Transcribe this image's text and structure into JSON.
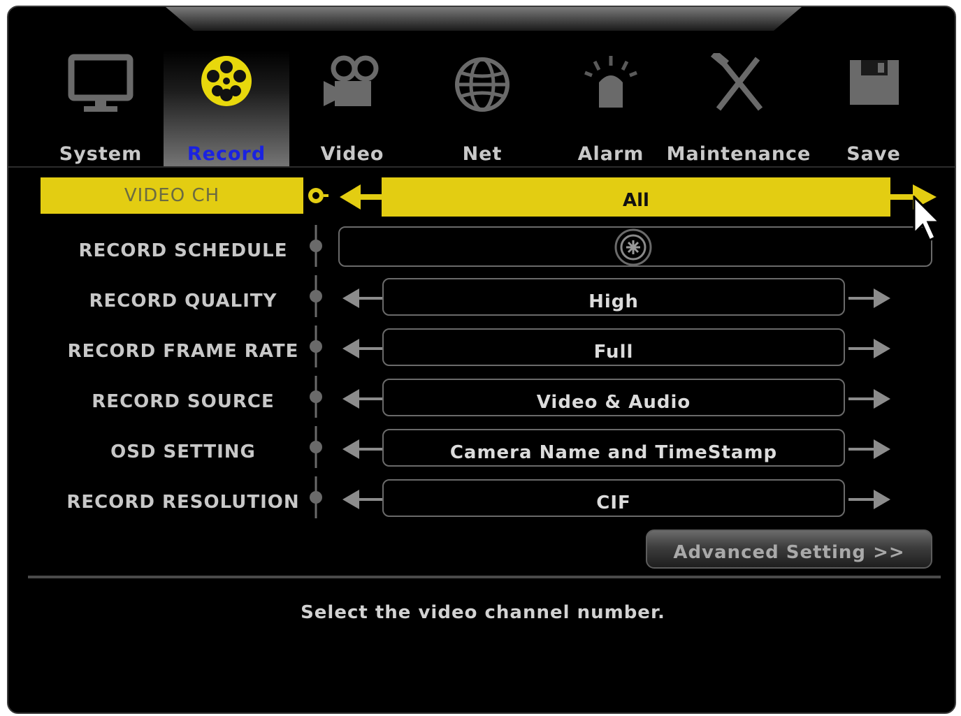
{
  "tabs": [
    {
      "label": "System",
      "icon": "monitor-icon"
    },
    {
      "label": "Record",
      "icon": "film-reel-icon",
      "active": true
    },
    {
      "label": "Video",
      "icon": "video-camera-icon"
    },
    {
      "label": "Net",
      "icon": "globe-icon"
    },
    {
      "label": "Alarm",
      "icon": "alarm-siren-icon"
    },
    {
      "label": "Maintenance",
      "icon": "tools-icon"
    },
    {
      "label": "Save",
      "icon": "floppy-disk-icon"
    }
  ],
  "settings": [
    {
      "label": "VIDEO CH",
      "value": "All",
      "selected": true
    },
    {
      "label": "RECORD SCHEDULE",
      "value": "",
      "control": "schedule-icon"
    },
    {
      "label": "RECORD QUALITY",
      "value": "High"
    },
    {
      "label": "RECORD FRAME RATE",
      "value": "Full"
    },
    {
      "label": "RECORD SOURCE",
      "value": "Video & Audio"
    },
    {
      "label": "OSD SETTING",
      "value": "Camera Name and TimeStamp"
    },
    {
      "label": "RECORD RESOLUTION",
      "value": "CIF"
    }
  ],
  "advanced_button": "Advanced Setting >>",
  "help_text": "Select the video channel number.",
  "colors": {
    "accent": "#e3cd12",
    "active_tab_text": "#1a22e0",
    "background": "#000000"
  }
}
